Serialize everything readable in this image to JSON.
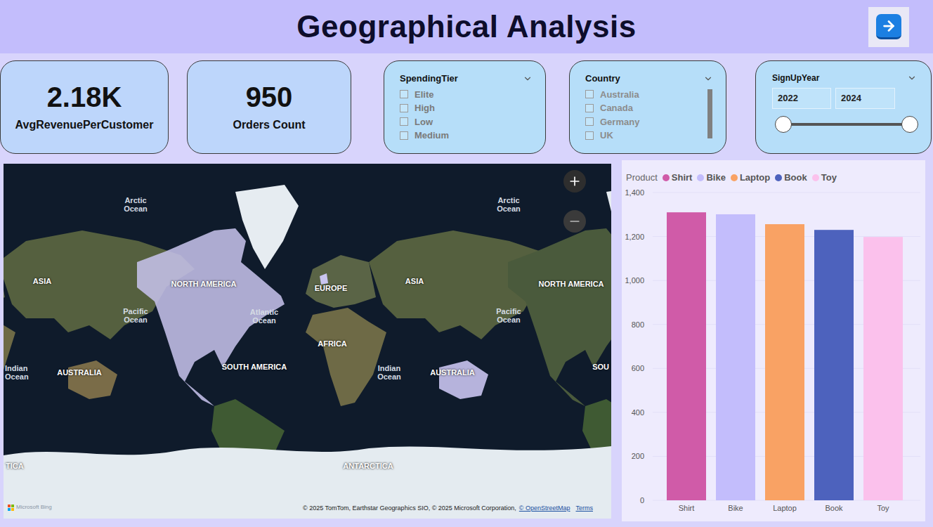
{
  "header": {
    "title": "Geographical Analysis"
  },
  "kpis": [
    {
      "value": "2.18K",
      "label": "AvgRevenuePerCustomer"
    },
    {
      "value": "950",
      "label": "Orders Count"
    }
  ],
  "slicers": {
    "spending_tier": {
      "title": "SpendingTier",
      "items": [
        {
          "label": "Elite",
          "selected": false
        },
        {
          "label": "High",
          "selected": false
        },
        {
          "label": "Low",
          "selected": false
        },
        {
          "label": "Medium",
          "selected": false
        }
      ]
    },
    "country": {
      "title": "Country",
      "items": [
        {
          "label": "Australia",
          "selected": false
        },
        {
          "label": "Canada",
          "selected": false
        },
        {
          "label": "Germany",
          "selected": false
        },
        {
          "label": "UK",
          "selected": false
        }
      ]
    },
    "signup_year": {
      "title": "SignUpYear",
      "from": "2022",
      "to": "2024",
      "range": [
        0,
        1
      ]
    }
  },
  "map": {
    "labels": [
      {
        "text": "Arctic Ocean",
        "kind": "ocean"
      },
      {
        "text": "Arctic Ocean",
        "kind": "ocean"
      },
      {
        "text": "ASIA",
        "kind": "continent"
      },
      {
        "text": "NORTH AMERICA",
        "kind": "continent"
      },
      {
        "text": "EUROPE",
        "kind": "continent"
      },
      {
        "text": "ASIA",
        "kind": "continent"
      },
      {
        "text": "NORTH AMERICA",
        "kind": "continent"
      },
      {
        "text": "Pacific Ocean",
        "kind": "ocean"
      },
      {
        "text": "Atlantic Ocean",
        "kind": "ocean"
      },
      {
        "text": "Pacific Ocean",
        "kind": "ocean"
      },
      {
        "text": "AFRICA",
        "kind": "continent"
      },
      {
        "text": "Indian Ocean",
        "kind": "ocean"
      },
      {
        "text": "AUSTRALIA",
        "kind": "continent"
      },
      {
        "text": "SOUTH AMERICA",
        "kind": "continent"
      },
      {
        "text": "Indian Ocean",
        "kind": "ocean"
      },
      {
        "text": "AUSTRALIA",
        "kind": "continent"
      },
      {
        "text": "SOU",
        "kind": "continent"
      },
      {
        "text": "TICA",
        "kind": "continent"
      },
      {
        "text": "ANTARCTICA",
        "kind": "continent"
      }
    ],
    "logo": "Microsoft Bing",
    "attribution": "© 2025 TomTom, Earthstar Geographics SIO, © 2025 Microsoft Corporation,",
    "attribution_link": "© OpenStreetMap",
    "terms": "Terms"
  },
  "chart": {
    "legend_title": "Product",
    "y_ticks": [
      "0",
      "200",
      "400",
      "600",
      "800",
      "1,000",
      "1,200",
      "1,400"
    ],
    "y_max": 1400,
    "bars": [
      {
        "label": "Shirt",
        "value": 1310,
        "color": "#d05ba8"
      },
      {
        "label": "Bike",
        "value": 1301,
        "color": "#c3bdfc"
      },
      {
        "label": "Laptop",
        "value": 1256,
        "color": "#f9a264"
      },
      {
        "label": "Book",
        "value": 1230,
        "color": "#4d62bd"
      },
      {
        "label": "Toy",
        "value": 1198,
        "color": "#fbc1ec"
      }
    ]
  }
}
